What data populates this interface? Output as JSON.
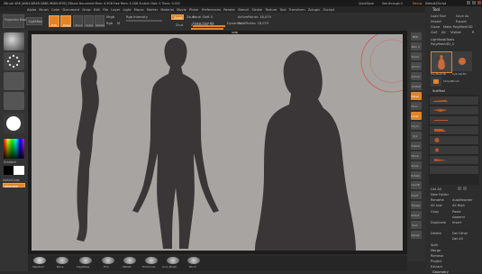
{
  "app": {
    "title": "ZBrush 4R6 [AIW4-WB4R-QB8S-9KW9-KFEE]  ZBrush Document  Mem: 6.9GB  Free Mem: 4.2GB  Scratch Disk: 0  Timer: 0.003",
    "quick_save": "QuickSave",
    "see_through": "See-through 0",
    "menus": "Menus",
    "default_script": "DefaultZScript"
  },
  "menubar": {
    "items": [
      "Alpha",
      "Brush",
      "Color",
      "Document",
      "Draw",
      "Edit",
      "File",
      "Layer",
      "Light",
      "Macro",
      "Marker",
      "Material",
      "Movie",
      "Picker",
      "Preferences",
      "Render",
      "Stencil",
      "Stroke",
      "Texture",
      "Tool",
      "Transform",
      "Zplugin",
      "Zscript"
    ]
  },
  "toolbar": {
    "projection_master": "Projection Master",
    "lightbox": "LightBox",
    "edit": "Edit",
    "draw": "Draw",
    "move": "Move",
    "scale": "Scale",
    "rotate": "Rotate",
    "mrgb": "Mrgb",
    "rgb": "Rgb",
    "m": "M",
    "zadd": "Zadd",
    "zsub": "Zsub",
    "zcut": "Zcut",
    "rgb_intensity": "Rgb Intensity",
    "focal_shift": "Focal Shift 0",
    "draw_size": "Draw Size 64",
    "dynamic": "Dynamic",
    "z_intensity": "Z Intensity 25",
    "active_points": "ActivePoints: 18,079",
    "total_points": "TotalPoints: 18,079"
  },
  "left_shelf": {
    "gradient_label": "Gradient",
    "switch_color": "SwitchColor",
    "alternate": "Alternate"
  },
  "canvas": {
    "top_label": "SUBJ"
  },
  "right_shelf": {
    "buttons": [
      "BPR",
      "SPix 3",
      "Scroll",
      "Zoom",
      "Actual",
      "AAHalf",
      "Persp",
      "Floor",
      "Local",
      "LSym",
      "Xyz",
      "Frame",
      "Move",
      "Scale",
      "Rotate",
      "Line Fill",
      "PolyF",
      "Transp",
      "Ghost",
      "Solo",
      "Xpose"
    ]
  },
  "right_panel": {
    "tool_header": "Tool",
    "load_tool": "Load Tool",
    "save_as": "Save As",
    "import": "Import",
    "export": "Export",
    "clone": "Clone",
    "make_polymesh": "Make PolyMesh3D",
    "goz": "GoZ",
    "all": "All",
    "visible": "Visible",
    "r": "R",
    "lightbox_tools": "Lightbox▸Tools",
    "current_tool": "PolyMesh3D_5",
    "tool_names": [
      "PolyMesh3D",
      "Cylinder3D",
      "SimpleBrush",
      "PolyMesh3D_5",
      "SimpleBrush",
      "Cylinder3D"
    ],
    "subtool": "SubTool",
    "list_all": "List All",
    "new_folder": "New Folder",
    "rename": "Rename",
    "auto_reorder": "AutoReorder",
    "all_low": "All Low",
    "all_high": "All High",
    "copy": "Copy",
    "paste": "Paste",
    "append": "Append",
    "duplicate": "Duplicate",
    "insert": "Insert",
    "delete": "Delete",
    "del_other": "Del Other",
    "del_all": "Del All",
    "split": "Split",
    "merge": "Merge",
    "remesh": "Remesh",
    "project": "Project",
    "extract": "Extract",
    "geometry": "Geometry"
  },
  "bottom_bar": {
    "brushes": [
      "Standard",
      "Move",
      "ClayTubes",
      "Trim",
      "hPolish",
      "TrimCurve",
      "Curv_Polish",
      "Pinch"
    ]
  },
  "colors": {
    "accent_orange": "#e0842a",
    "canvas_gray": "#a8a4a2",
    "silhouette": "#3a3637",
    "red_circle": "#d04a4a"
  }
}
